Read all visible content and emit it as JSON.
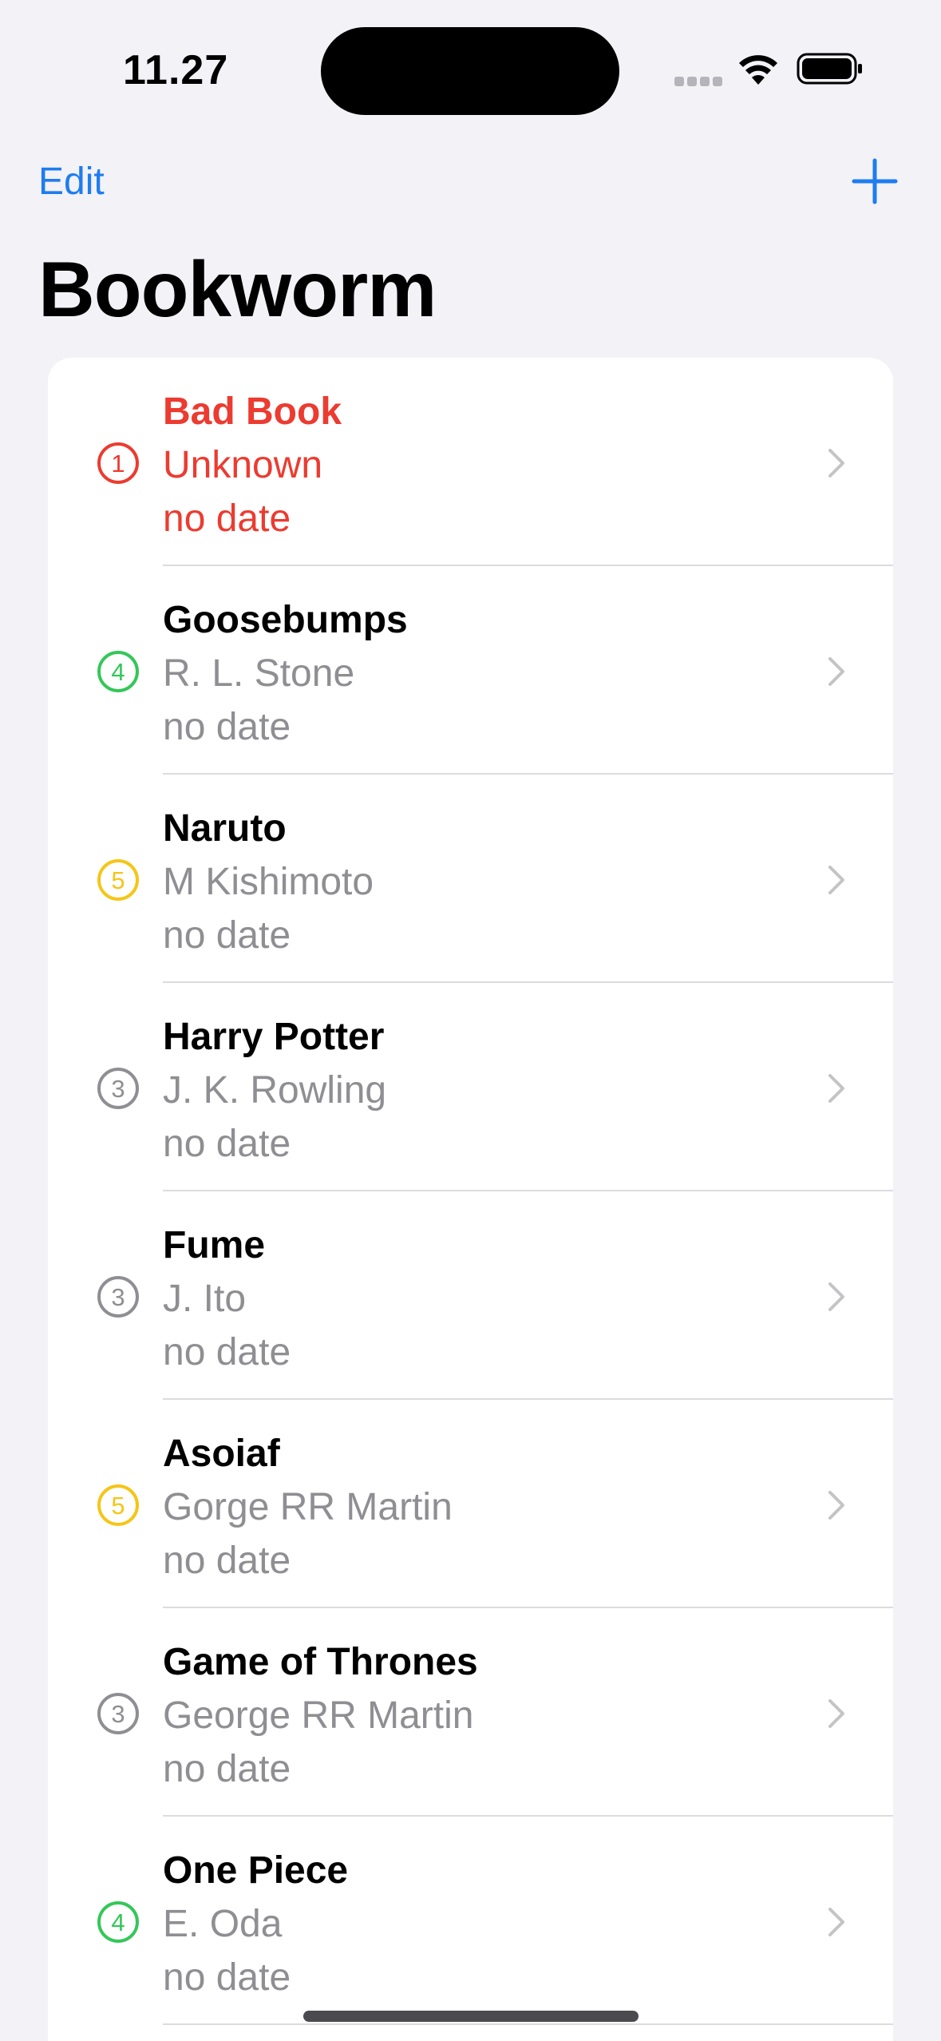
{
  "status_bar": {
    "time": "11.27"
  },
  "nav": {
    "edit_label": "Edit",
    "title": "Bookworm"
  },
  "colors": {
    "accent": "#1e7cf0",
    "bad": "#ec3b30",
    "green": "#34c759",
    "yellow": "#f5c518",
    "gray": "#8e8e93"
  },
  "books": [
    {
      "title": "Bad Book",
      "author": "Unknown",
      "date": "no date",
      "rating": "1",
      "rating_color": "#ec3b30",
      "bad": true
    },
    {
      "title": "Goosebumps",
      "author": "R. L. Stone",
      "date": "no date",
      "rating": "4",
      "rating_color": "#34c759",
      "bad": false
    },
    {
      "title": "Naruto",
      "author": "M Kishimoto",
      "date": "no date",
      "rating": "5",
      "rating_color": "#f5c518",
      "bad": false
    },
    {
      "title": "Harry Potter",
      "author": "J. K. Rowling",
      "date": "no date",
      "rating": "3",
      "rating_color": "#8e8e93",
      "bad": false
    },
    {
      "title": "Fume",
      "author": "J. Ito",
      "date": "no date",
      "rating": "3",
      "rating_color": "#8e8e93",
      "bad": false
    },
    {
      "title": "Asoiaf",
      "author": "Gorge RR Martin",
      "date": "no date",
      "rating": "5",
      "rating_color": "#f5c518",
      "bad": false
    },
    {
      "title": "Game of Thrones",
      "author": "George RR Martin",
      "date": "no date",
      "rating": "3",
      "rating_color": "#8e8e93",
      "bad": false
    },
    {
      "title": "One Piece",
      "author": "E. Oda",
      "date": "no date",
      "rating": "4",
      "rating_color": "#34c759",
      "bad": false
    }
  ]
}
